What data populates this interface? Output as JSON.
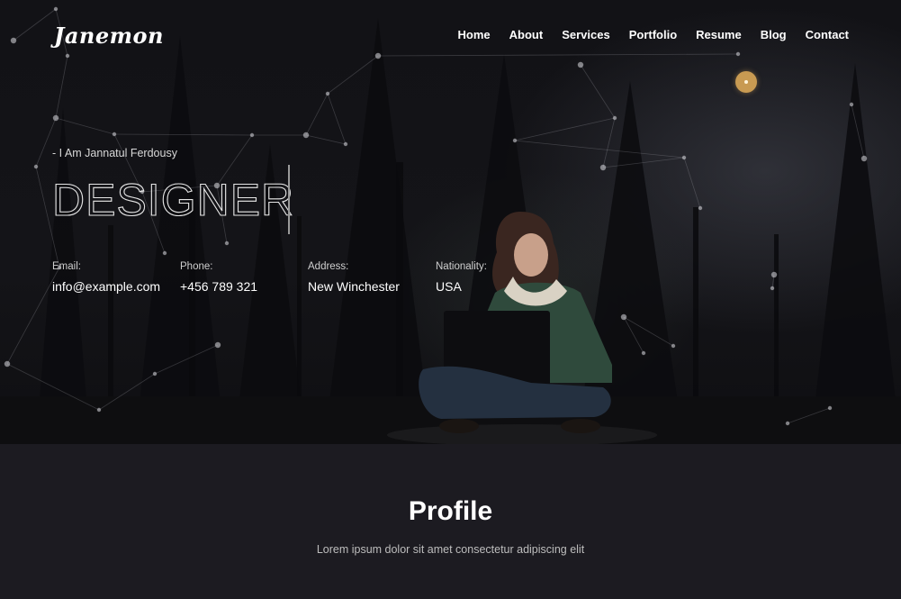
{
  "brand": {
    "logo_text": "Janemon"
  },
  "nav": {
    "items": [
      "Home",
      "About",
      "Services",
      "Portfolio",
      "Resume",
      "Blog",
      "Contact"
    ]
  },
  "hero": {
    "intro": "- I Am Jannatul Ferdousy",
    "role": "DESIGNER",
    "info": [
      {
        "label": "Email:",
        "value": "info@example.com"
      },
      {
        "label": "Phone:",
        "value": "+456 789 321"
      },
      {
        "label": "Address:",
        "value": "New Winchester"
      },
      {
        "label": "Nationality:",
        "value": "USA"
      }
    ]
  },
  "profile": {
    "title": "Profile",
    "subtitle": "Lorem ipsum dolor sit amet consectetur adipiscing elit"
  },
  "colors": {
    "accent": "#c89a52",
    "background": "#1c1b21",
    "hero_bg": "#121216"
  }
}
